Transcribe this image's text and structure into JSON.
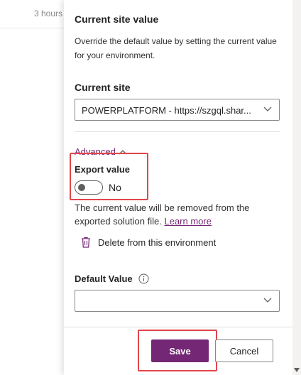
{
  "background": {
    "row_time": "3 hours"
  },
  "panel": {
    "section_title": "Current site value",
    "section_description": "Override the default value by setting the current value for your environment.",
    "current_site_label": "Current site",
    "current_site_value": "POWERPLATFORM - https://szgql.shar...",
    "advanced_label": "Advanced",
    "export_value_label": "Export value",
    "export_toggle_state": "No",
    "export_description": "The current value will be removed from the exported solution file.",
    "learn_more_link": "Learn more",
    "delete_label": "Delete from this environment",
    "default_value_label": "Default Value",
    "default_value_value": ""
  },
  "footer": {
    "save_label": "Save",
    "cancel_label": "Cancel"
  },
  "colors": {
    "accent": "#742774",
    "highlight": "#e0474c",
    "border": "#8a8886"
  }
}
